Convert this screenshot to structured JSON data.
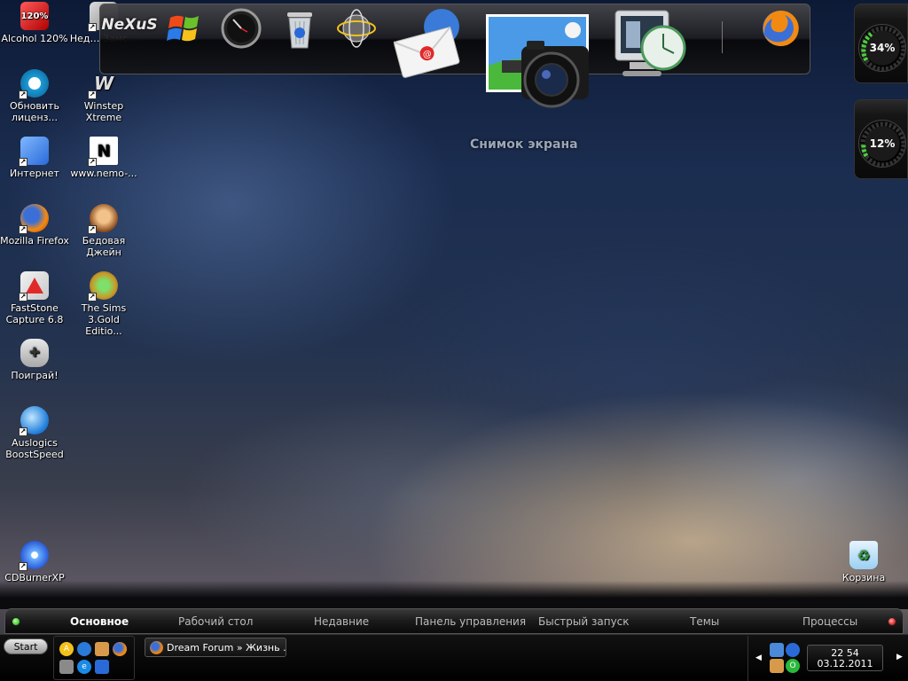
{
  "desktop_icons": [
    {
      "label": "Alcohol 120%",
      "icon": "alcohol-icon",
      "badge": "120%"
    },
    {
      "label": "Нед… Замс…",
      "icon": "app-icon"
    },
    {
      "label": "Обновить лиценз...",
      "icon": "update-license-icon"
    },
    {
      "label": "Winstep Xtreme",
      "icon": "winstep-icon"
    },
    {
      "label": "Интернет",
      "icon": "internet-icon"
    },
    {
      "label": "www.nemo-...",
      "icon": "nemo-icon",
      "badge": "N"
    },
    {
      "label": "Mozilla Firefox",
      "icon": "firefox-icon"
    },
    {
      "label": "Бедовая Джейн",
      "icon": "game-jane-icon"
    },
    {
      "label": "FastStone Capture 6.8",
      "icon": "faststone-icon"
    },
    {
      "label": "The Sims 3.Gold Editio...",
      "icon": "sims-icon"
    },
    {
      "label": "Поиграй!",
      "icon": "gamepad-icon"
    },
    {
      "label": "Auslogics BoostSpeed",
      "icon": "auslogics-icon"
    },
    {
      "label": "CDBurnerXP",
      "icon": "cdburner-icon"
    },
    {
      "label": "Корзина",
      "icon": "recycle-bin-icon"
    }
  ],
  "dock": {
    "items": [
      {
        "name": "nexus-logo",
        "text": "NeXuS"
      },
      {
        "name": "windows-logo-icon"
      },
      {
        "name": "clock-gadget-icon"
      },
      {
        "name": "recycle-bin-icon"
      },
      {
        "name": "network-globe-icon"
      },
      {
        "name": "mail-icon"
      },
      {
        "name": "camera-screenshot-icon"
      },
      {
        "name": "monitor-clock-icon"
      },
      {
        "name": "firefox-icon"
      }
    ],
    "caption": "Снимок экрана"
  },
  "gauges": [
    {
      "name": "cpu-gauge",
      "value": "34%"
    },
    {
      "name": "memory-gauge",
      "value": "12%"
    }
  ],
  "category_bar": {
    "items": [
      "Основное",
      "Рабочий стол",
      "Недавние",
      "Панель управления",
      "Быстрый запуск",
      "Темы",
      "Процессы"
    ],
    "active": "Основное"
  },
  "taskbar": {
    "start_label": "Start",
    "task_button": "Dream Forum » Жизнь ...",
    "clock_time": "22 54",
    "clock_date": "03.12.2011"
  },
  "colors": {
    "accent_green": "#4cd23c",
    "accent_red": "#e02a2a",
    "firefox_orange": "#f28a12"
  }
}
